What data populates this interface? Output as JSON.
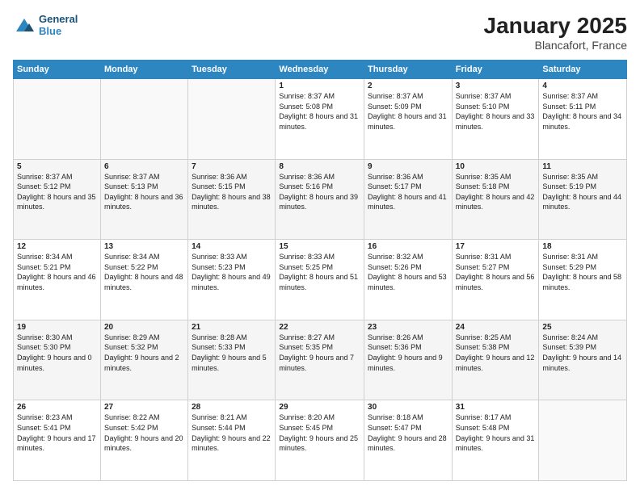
{
  "logo": {
    "line1": "General",
    "line2": "Blue"
  },
  "title": "January 2025",
  "location": "Blancafort, France",
  "weekdays": [
    "Sunday",
    "Monday",
    "Tuesday",
    "Wednesday",
    "Thursday",
    "Friday",
    "Saturday"
  ],
  "weeks": [
    [
      {
        "day": "",
        "info": ""
      },
      {
        "day": "",
        "info": ""
      },
      {
        "day": "",
        "info": ""
      },
      {
        "day": "1",
        "info": "Sunrise: 8:37 AM\nSunset: 5:08 PM\nDaylight: 8 hours and 31 minutes."
      },
      {
        "day": "2",
        "info": "Sunrise: 8:37 AM\nSunset: 5:09 PM\nDaylight: 8 hours and 31 minutes."
      },
      {
        "day": "3",
        "info": "Sunrise: 8:37 AM\nSunset: 5:10 PM\nDaylight: 8 hours and 33 minutes."
      },
      {
        "day": "4",
        "info": "Sunrise: 8:37 AM\nSunset: 5:11 PM\nDaylight: 8 hours and 34 minutes."
      }
    ],
    [
      {
        "day": "5",
        "info": "Sunrise: 8:37 AM\nSunset: 5:12 PM\nDaylight: 8 hours and 35 minutes."
      },
      {
        "day": "6",
        "info": "Sunrise: 8:37 AM\nSunset: 5:13 PM\nDaylight: 8 hours and 36 minutes."
      },
      {
        "day": "7",
        "info": "Sunrise: 8:36 AM\nSunset: 5:15 PM\nDaylight: 8 hours and 38 minutes."
      },
      {
        "day": "8",
        "info": "Sunrise: 8:36 AM\nSunset: 5:16 PM\nDaylight: 8 hours and 39 minutes."
      },
      {
        "day": "9",
        "info": "Sunrise: 8:36 AM\nSunset: 5:17 PM\nDaylight: 8 hours and 41 minutes."
      },
      {
        "day": "10",
        "info": "Sunrise: 8:35 AM\nSunset: 5:18 PM\nDaylight: 8 hours and 42 minutes."
      },
      {
        "day": "11",
        "info": "Sunrise: 8:35 AM\nSunset: 5:19 PM\nDaylight: 8 hours and 44 minutes."
      }
    ],
    [
      {
        "day": "12",
        "info": "Sunrise: 8:34 AM\nSunset: 5:21 PM\nDaylight: 8 hours and 46 minutes."
      },
      {
        "day": "13",
        "info": "Sunrise: 8:34 AM\nSunset: 5:22 PM\nDaylight: 8 hours and 48 minutes."
      },
      {
        "day": "14",
        "info": "Sunrise: 8:33 AM\nSunset: 5:23 PM\nDaylight: 8 hours and 49 minutes."
      },
      {
        "day": "15",
        "info": "Sunrise: 8:33 AM\nSunset: 5:25 PM\nDaylight: 8 hours and 51 minutes."
      },
      {
        "day": "16",
        "info": "Sunrise: 8:32 AM\nSunset: 5:26 PM\nDaylight: 8 hours and 53 minutes."
      },
      {
        "day": "17",
        "info": "Sunrise: 8:31 AM\nSunset: 5:27 PM\nDaylight: 8 hours and 56 minutes."
      },
      {
        "day": "18",
        "info": "Sunrise: 8:31 AM\nSunset: 5:29 PM\nDaylight: 8 hours and 58 minutes."
      }
    ],
    [
      {
        "day": "19",
        "info": "Sunrise: 8:30 AM\nSunset: 5:30 PM\nDaylight: 9 hours and 0 minutes."
      },
      {
        "day": "20",
        "info": "Sunrise: 8:29 AM\nSunset: 5:32 PM\nDaylight: 9 hours and 2 minutes."
      },
      {
        "day": "21",
        "info": "Sunrise: 8:28 AM\nSunset: 5:33 PM\nDaylight: 9 hours and 5 minutes."
      },
      {
        "day": "22",
        "info": "Sunrise: 8:27 AM\nSunset: 5:35 PM\nDaylight: 9 hours and 7 minutes."
      },
      {
        "day": "23",
        "info": "Sunrise: 8:26 AM\nSunset: 5:36 PM\nDaylight: 9 hours and 9 minutes."
      },
      {
        "day": "24",
        "info": "Sunrise: 8:25 AM\nSunset: 5:38 PM\nDaylight: 9 hours and 12 minutes."
      },
      {
        "day": "25",
        "info": "Sunrise: 8:24 AM\nSunset: 5:39 PM\nDaylight: 9 hours and 14 minutes."
      }
    ],
    [
      {
        "day": "26",
        "info": "Sunrise: 8:23 AM\nSunset: 5:41 PM\nDaylight: 9 hours and 17 minutes."
      },
      {
        "day": "27",
        "info": "Sunrise: 8:22 AM\nSunset: 5:42 PM\nDaylight: 9 hours and 20 minutes."
      },
      {
        "day": "28",
        "info": "Sunrise: 8:21 AM\nSunset: 5:44 PM\nDaylight: 9 hours and 22 minutes."
      },
      {
        "day": "29",
        "info": "Sunrise: 8:20 AM\nSunset: 5:45 PM\nDaylight: 9 hours and 25 minutes."
      },
      {
        "day": "30",
        "info": "Sunrise: 8:18 AM\nSunset: 5:47 PM\nDaylight: 9 hours and 28 minutes."
      },
      {
        "day": "31",
        "info": "Sunrise: 8:17 AM\nSunset: 5:48 PM\nDaylight: 9 hours and 31 minutes."
      },
      {
        "day": "",
        "info": ""
      }
    ]
  ]
}
